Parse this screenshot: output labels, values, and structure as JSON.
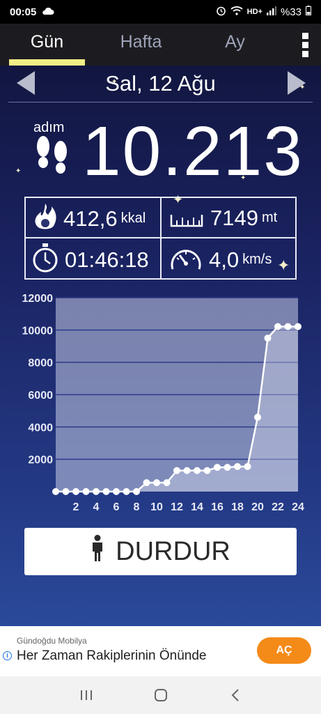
{
  "status_bar": {
    "time": "00:05",
    "battery": "%33"
  },
  "tabs": [
    {
      "label": "Gün",
      "active": true
    },
    {
      "label": "Hafta",
      "active": false
    },
    {
      "label": "Ay",
      "active": false
    }
  ],
  "date_nav": {
    "date": "Sal, 12 Ağu"
  },
  "steps": {
    "label": "adım",
    "value": "10.213"
  },
  "stats": {
    "calories": {
      "value": "412,6",
      "unit": "kkal"
    },
    "distance": {
      "value": "7149",
      "unit": "mt"
    },
    "duration": {
      "value": "01:46:18"
    },
    "speed": {
      "value": "4,0",
      "unit": "km/s"
    }
  },
  "chart_data": {
    "type": "line",
    "x": [
      0,
      1,
      2,
      3,
      4,
      5,
      6,
      7,
      8,
      9,
      10,
      11,
      12,
      13,
      14,
      15,
      16,
      17,
      18,
      19,
      20,
      21,
      22,
      23,
      24
    ],
    "series": [
      {
        "values": [
          0,
          0,
          0,
          0,
          0,
          0,
          0,
          0,
          0,
          550,
          550,
          550,
          1300,
          1300,
          1300,
          1300,
          1500,
          1500,
          1550,
          1550,
          4600,
          9500,
          10213,
          10213,
          10213
        ]
      }
    ],
    "x_ticks": [
      "2",
      "4",
      "6",
      "8",
      "10",
      "12",
      "14",
      "16",
      "18",
      "20",
      "22",
      "24"
    ],
    "y_ticks": [
      "2000",
      "4000",
      "6000",
      "8000",
      "10000",
      "12000"
    ],
    "xlim": [
      0,
      24
    ],
    "ylim": [
      0,
      12000
    ],
    "grid": true
  },
  "stop_button": {
    "label": "DURDUR"
  },
  "ad": {
    "brand": "Gündoğdu Mobilya",
    "headline": "Her Zaman Rakiplerinin Önünde",
    "cta": "AÇ"
  }
}
